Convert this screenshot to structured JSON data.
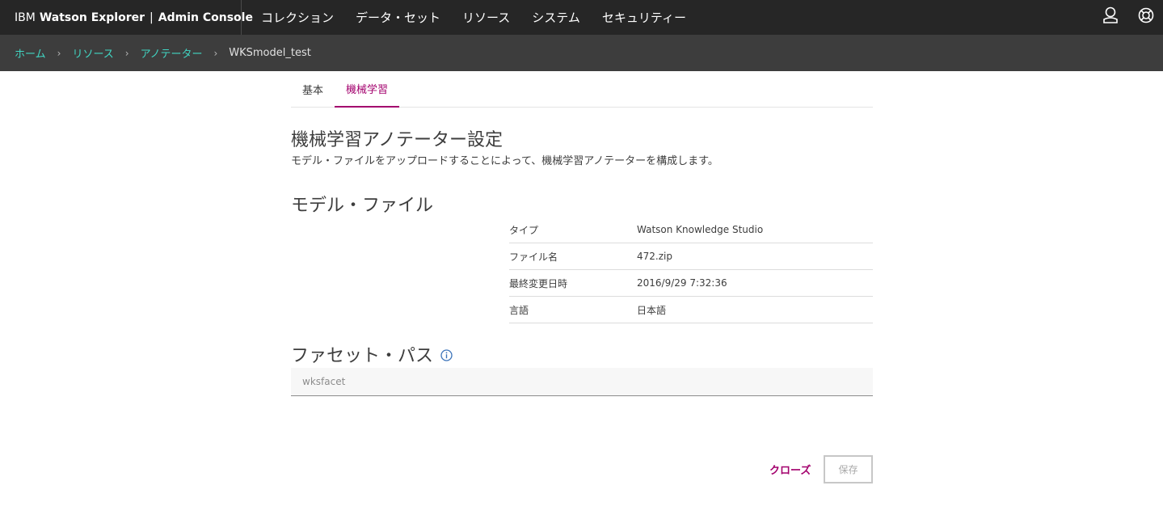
{
  "header": {
    "brand_prefix": "IBM",
    "brand_product": "Watson Explorer",
    "brand_separator": "|",
    "brand_console": "Admin Console",
    "nav": [
      "コレクション",
      "データ・セット",
      "リソース",
      "システム",
      "セキュリティー"
    ],
    "icons": [
      "user-icon",
      "help-lifebuoy-icon"
    ]
  },
  "breadcrumb": {
    "items": [
      "ホーム",
      "リソース",
      "アノテーター"
    ],
    "current": "WKSmodel_test"
  },
  "tabs": [
    "基本",
    "機械学習"
  ],
  "active_tab": "機械学習",
  "section": {
    "title": "機械学習アノテーター設定",
    "description": "モデル・ファイルをアップロードすることによって、機械学習アノテーターを構成します。"
  },
  "model_file": {
    "heading": "モデル・ファイル",
    "rows": [
      {
        "label": "タイプ",
        "value": "Watson Knowledge Studio"
      },
      {
        "label": "ファイル名",
        "value": "472.zip"
      },
      {
        "label": "最終変更日時",
        "value": "2016/9/29 7:32:36"
      },
      {
        "label": "言語",
        "value": "日本語"
      }
    ]
  },
  "facet_path": {
    "heading": "ファセット・パス",
    "placeholder": "wksfacet",
    "value": ""
  },
  "actions": {
    "close_label": "クローズ",
    "save_label": "保存"
  },
  "colors": {
    "topbar_bg": "#262626",
    "breadcrumb_bg": "#3d3d3d",
    "breadcrumb_link": "#41d6c3",
    "accent": "#a3006d",
    "info_icon": "#3b73b9"
  }
}
